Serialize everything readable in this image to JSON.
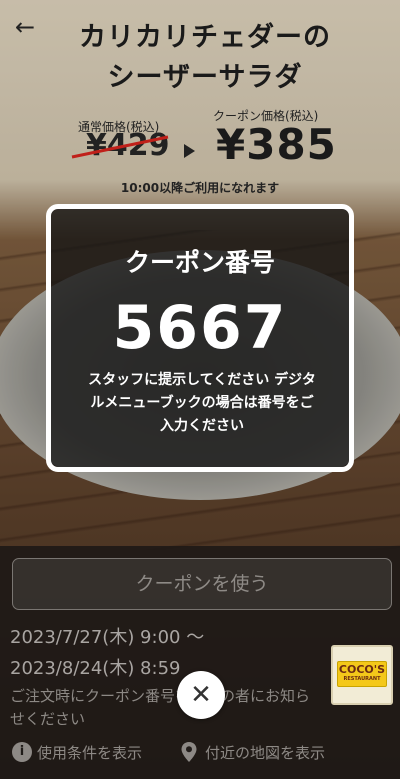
{
  "header": {
    "back_icon": "back-arrow-icon",
    "title_line1": "カリカリチェダーの",
    "title_line2": "シーザーサラダ"
  },
  "pricing": {
    "regular_label": "通常価格(税込)",
    "regular_price": "¥429",
    "coupon_label": "クーポン価格(税込)",
    "coupon_price": "¥385",
    "availability_note": "10:00以降ご利用になれます"
  },
  "coupon_card": {
    "title": "クーポン番号",
    "number": "5667",
    "instruction": "スタッフに提示してください デジタルメニューブックの場合は番号をご入力ください"
  },
  "actions": {
    "use_coupon_label": "クーポンを使う"
  },
  "validity": {
    "start": "2023/7/27(木) 9:00 〜",
    "end": "2023/8/24(木) 8:59",
    "note": "ご注文時にクーポン番号をお店の者にお知らせください"
  },
  "brand": {
    "logo_text": "COCO'S",
    "logo_sub": "RESTAURANT"
  },
  "footer": {
    "terms_label": "使用条件を表示",
    "map_label": "付近の地図を表示",
    "close_icon": "close-icon"
  },
  "colors": {
    "card_border": "#ffffff",
    "logo_yellow": "#f4c81a"
  }
}
